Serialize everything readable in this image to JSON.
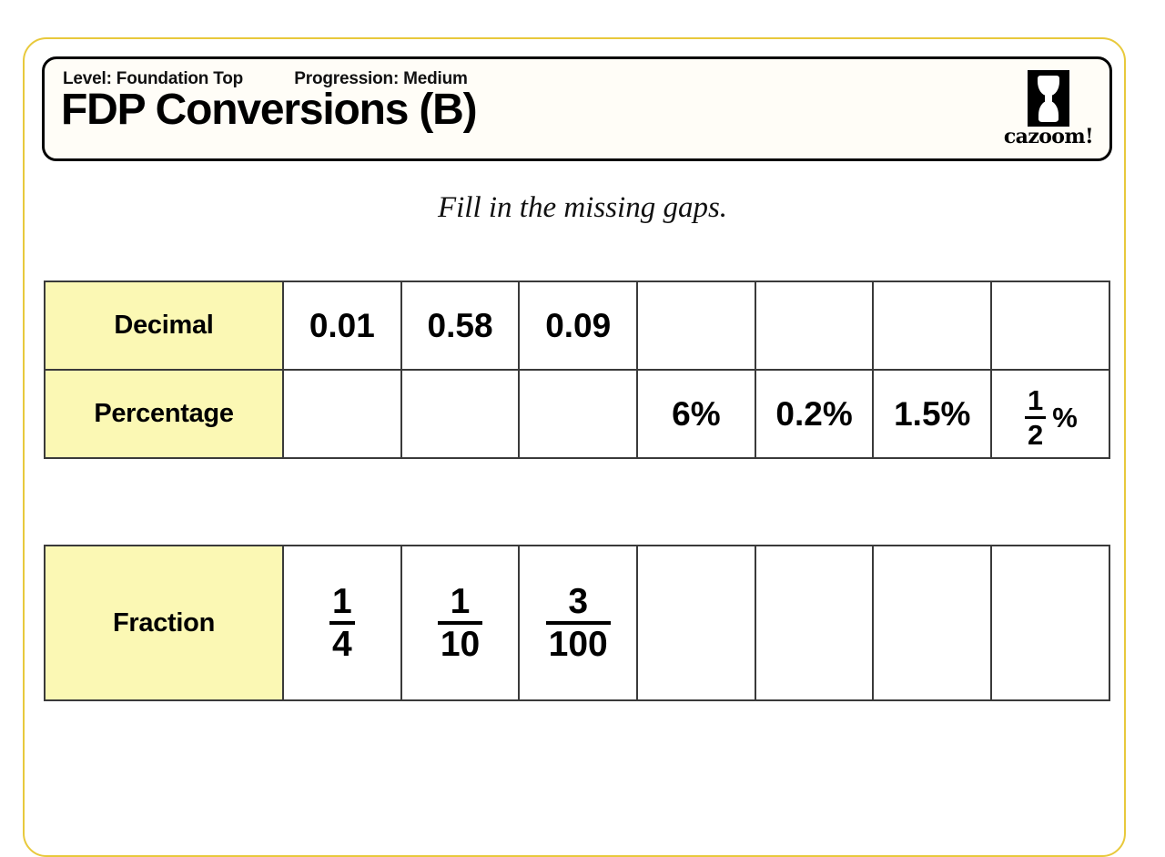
{
  "header": {
    "level_label": "Level: Foundation Top",
    "progression_label": "Progression: Medium",
    "title": "FDP Conversions (B)",
    "logo_text": "cazoom!",
    "logo_icon": "cazoom-vase-icon"
  },
  "instruction": "Fill in the missing gaps.",
  "colors": {
    "page_border": "#e8c93c",
    "header_fill": "#fffdf7",
    "row_label_fill": "#fbf8b4",
    "grid_line": "#3a3a3a",
    "text": "#000000"
  },
  "tables": [
    {
      "id": "decimal-percentage-table",
      "rows": [
        {
          "label": "Decimal",
          "name": "decimal-row",
          "cells": [
            {
              "type": "text",
              "value": "0.01"
            },
            {
              "type": "text",
              "value": "0.58"
            },
            {
              "type": "text",
              "value": "0.09"
            },
            {
              "type": "blank",
              "value": ""
            },
            {
              "type": "blank",
              "value": ""
            },
            {
              "type": "blank",
              "value": ""
            },
            {
              "type": "blank",
              "value": ""
            }
          ]
        },
        {
          "label": "Percentage",
          "name": "percentage-row",
          "cells": [
            {
              "type": "blank",
              "value": ""
            },
            {
              "type": "blank",
              "value": ""
            },
            {
              "type": "blank",
              "value": ""
            },
            {
              "type": "text",
              "value": "6%"
            },
            {
              "type": "text",
              "value": "0.2%"
            },
            {
              "type": "text",
              "value": "1.5%"
            },
            {
              "type": "fraction_percent",
              "numerator": "1",
              "denominator": "2",
              "suffix": "%"
            }
          ]
        }
      ]
    },
    {
      "id": "fraction-table",
      "rows": [
        {
          "label": "Fraction",
          "name": "fraction-row",
          "cells": [
            {
              "type": "fraction",
              "numerator": "1",
              "denominator": "4"
            },
            {
              "type": "fraction",
              "numerator": "1",
              "denominator": "10"
            },
            {
              "type": "fraction",
              "numerator": "3",
              "denominator": "100"
            },
            {
              "type": "blank",
              "value": ""
            },
            {
              "type": "blank",
              "value": ""
            },
            {
              "type": "blank",
              "value": ""
            },
            {
              "type": "blank",
              "value": ""
            }
          ]
        }
      ]
    }
  ]
}
